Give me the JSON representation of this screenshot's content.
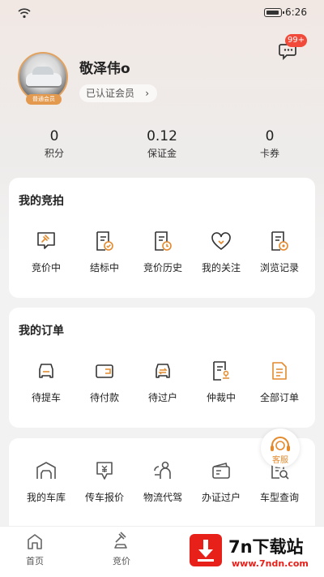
{
  "status_bar": {
    "time": "6:26"
  },
  "profile": {
    "name": "敬泽伟o",
    "member_badge": "普通会员",
    "verified_label": "已认证会员",
    "chevron": "›",
    "message_badge": "99+"
  },
  "stats": [
    {
      "value": "0",
      "label": "积分"
    },
    {
      "value": "0.12",
      "label": "保证金"
    },
    {
      "value": "0",
      "label": "卡券"
    }
  ],
  "auction": {
    "title": "我的竞拍",
    "items": [
      {
        "label": "竞价中",
        "icon": "gavel-chat-icon"
      },
      {
        "label": "结标中",
        "icon": "document-check-icon"
      },
      {
        "label": "竞价历史",
        "icon": "document-clock-icon"
      },
      {
        "label": "我的关注",
        "icon": "heart-icon"
      },
      {
        "label": "浏览记录",
        "icon": "document-view-icon"
      }
    ]
  },
  "orders": {
    "title": "我的订单",
    "items": [
      {
        "label": "待提车",
        "icon": "car-front-icon"
      },
      {
        "label": "待付款",
        "icon": "wallet-icon"
      },
      {
        "label": "待过户",
        "icon": "car-transfer-icon"
      },
      {
        "label": "仲裁中",
        "icon": "document-stamp-icon"
      },
      {
        "label": "全部订单",
        "icon": "orders-icon"
      }
    ]
  },
  "services": {
    "items": [
      {
        "label": "我的车库",
        "icon": "garage-icon"
      },
      {
        "label": "传车报价",
        "icon": "price-tag-icon"
      },
      {
        "label": "物流代驾",
        "icon": "driver-icon"
      },
      {
        "label": "办证过户",
        "icon": "certificate-icon"
      },
      {
        "label": "车型查询",
        "icon": "search-document-icon"
      }
    ],
    "floating_label": "客服"
  },
  "bottom_nav": [
    {
      "label": "首页",
      "icon": "home-icon"
    },
    {
      "label": "竞价",
      "icon": "bid-icon"
    }
  ],
  "watermark": {
    "title": "7n下载站",
    "url": "www.7ndn.com"
  },
  "colors": {
    "accent": "#e48a2d",
    "badge": "#f24a3a",
    "icon": "#333333"
  }
}
